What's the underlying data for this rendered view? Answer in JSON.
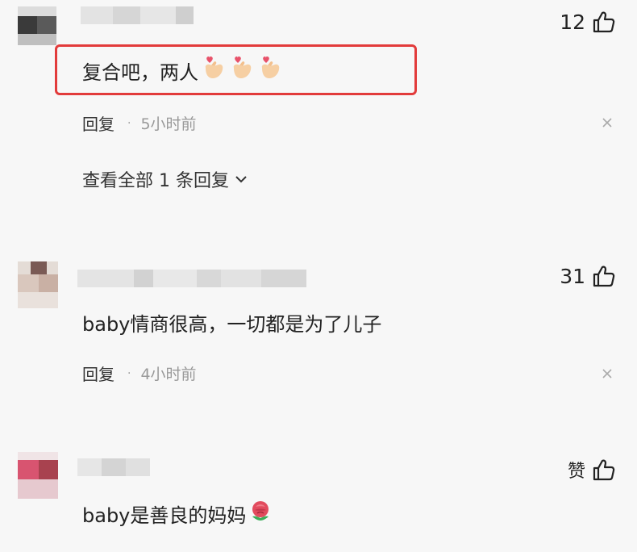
{
  "comments": [
    {
      "text": "复合吧，两人",
      "emoji": [
        "finger-heart",
        "finger-heart",
        "finger-heart"
      ],
      "likes": "12",
      "reply_label": "回复",
      "separator": "·",
      "time": "5小时前",
      "view_replies": "查看全部 1 条回复",
      "highlighted": true
    },
    {
      "text": "baby情商很高，一切都是为了儿子",
      "likes": "31",
      "reply_label": "回复",
      "separator": "·",
      "time": "4小时前"
    },
    {
      "text": "baby是善良的妈妈",
      "emoji": [
        "rose"
      ],
      "likes": "赞"
    }
  ],
  "colors": {
    "highlight_border": "#e23b3b",
    "background": "#f7f7f7",
    "muted_text": "#999999"
  },
  "icons": [
    "thumbs-up-icon",
    "close-icon",
    "chevron-down-icon",
    "finger-heart-emoji",
    "rose-emoji"
  ]
}
